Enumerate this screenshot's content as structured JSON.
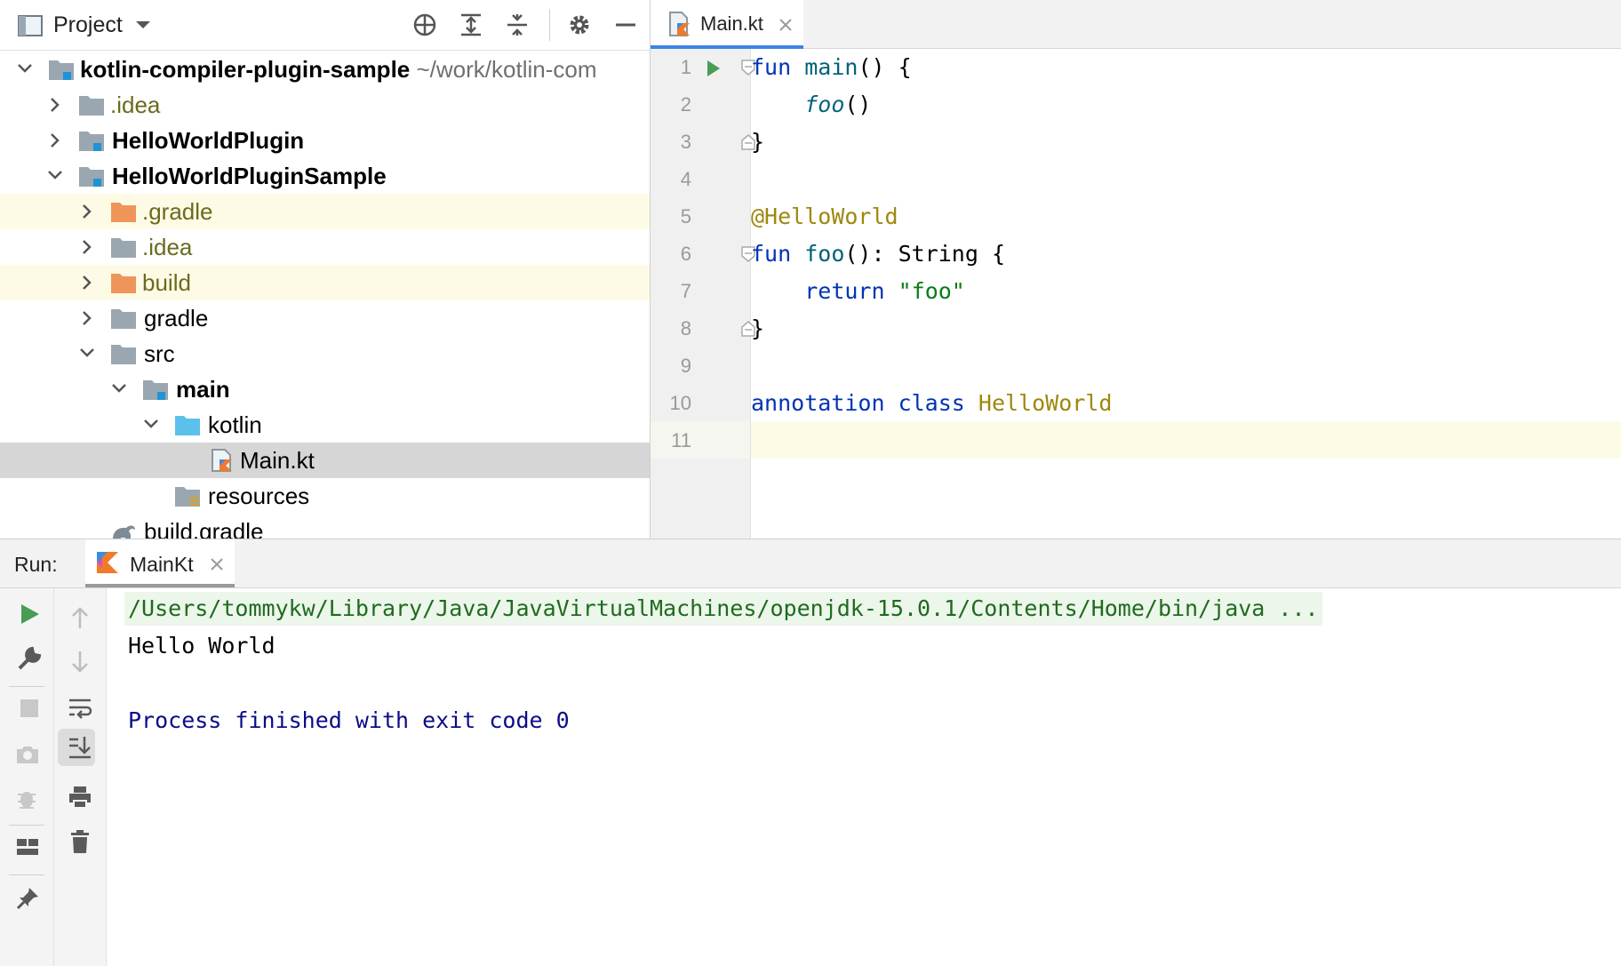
{
  "project_panel": {
    "title": "Project",
    "tree": [
      {
        "label": "kotlin-compiler-plugin-sample",
        "suffix": "~/work/kotlin-com"
      },
      {
        "label": ".idea"
      },
      {
        "label": "HelloWorldPlugin"
      },
      {
        "label": "HelloWorldPluginSample"
      },
      {
        "label": ".gradle"
      },
      {
        "label": ".idea"
      },
      {
        "label": "build"
      },
      {
        "label": "gradle"
      },
      {
        "label": "src"
      },
      {
        "label": "main"
      },
      {
        "label": "kotlin"
      },
      {
        "label": "Main.kt"
      },
      {
        "label": "resources"
      },
      {
        "label": "build.gradle"
      }
    ]
  },
  "editor": {
    "tab_label": "Main.kt",
    "line_numbers": [
      "1",
      "2",
      "3",
      "4",
      "5",
      "6",
      "7",
      "8",
      "9",
      "10",
      "11"
    ],
    "code": {
      "l1_fun": "fun",
      "l1_name": "main",
      "l1_rest": "() {",
      "l2_call": "foo",
      "l2_rest": "()",
      "l3": "}",
      "l5": "@HelloWorld",
      "l6_fun": "fun",
      "l6_name": "foo",
      "l6_rest": "(): String {",
      "l7_kw": "return",
      "l7_str": "\"foo\"",
      "l8": "}",
      "l10_kw": "annotation class",
      "l10_name": "HelloWorld"
    }
  },
  "run_panel": {
    "label": "Run:",
    "tab_label": "MainKt",
    "console": {
      "command": "/Users/tommykw/Library/Java/JavaVirtualMachines/openjdk-15.0.1/Contents/Home/bin/java ...",
      "output": "Hello World",
      "finished": "Process finished with exit code 0"
    }
  },
  "colors": {
    "keyword": "#0033b3",
    "function": "#00627a",
    "annotation": "#9e880d",
    "string": "#067d17",
    "tab_accent": "#3c83e6",
    "run_green": "#499c54"
  }
}
